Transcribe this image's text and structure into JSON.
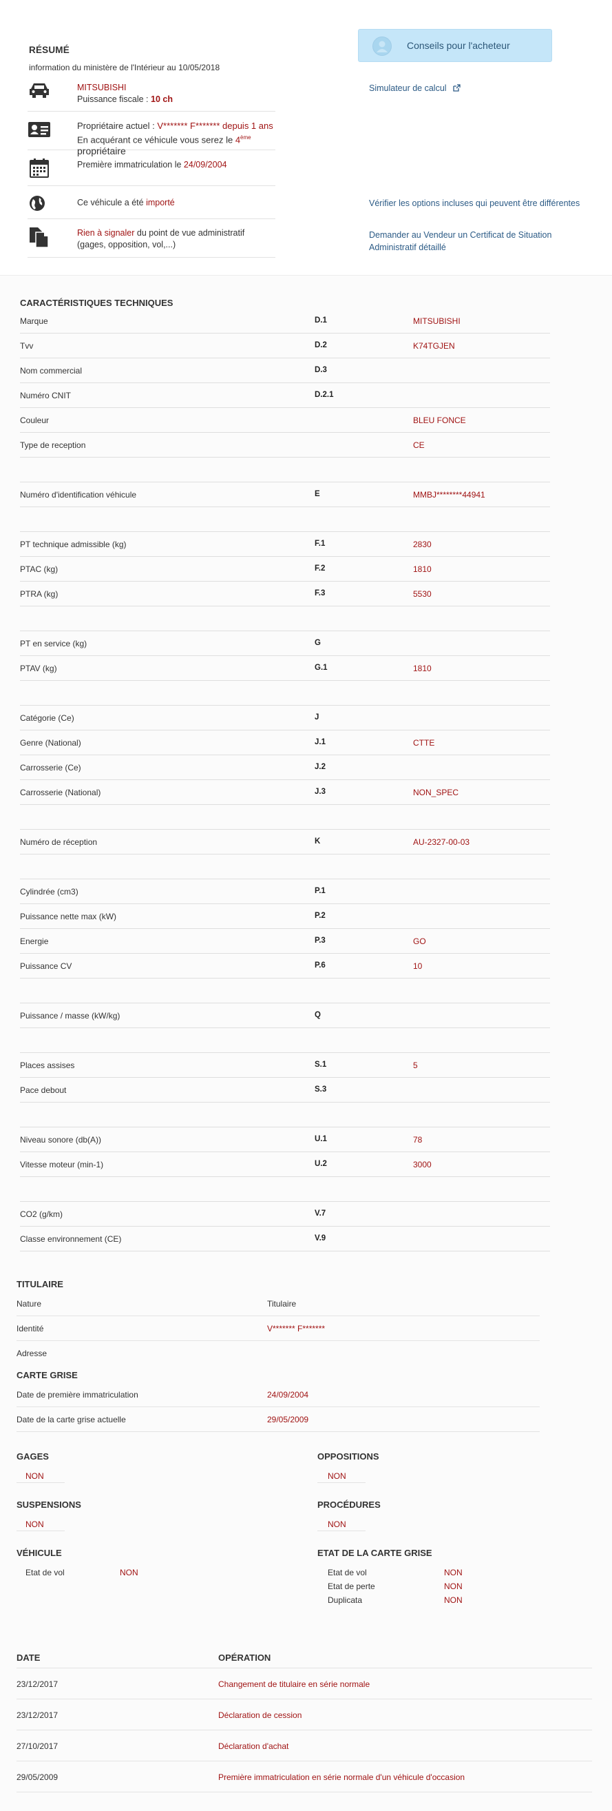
{
  "summary": {
    "title": "RÉSUMÉ",
    "subtitle": "information du ministère de l'Intérieur au 10/05/2018",
    "brand": "MITSUBISHI",
    "fiscal_label": "Puissance fiscale : ",
    "fiscal_value": "10 ch",
    "owner_label": "Propriétaire actuel : ",
    "owner_value": "V******* F******* depuis 1 ans",
    "owner_line2_a": "En acquérant ce véhicule vous serez le ",
    "owner_rank": "4",
    "owner_rank_sup": "ème",
    "owner_line2_b": " propriétaire",
    "first_reg_label": "Première immatriculation le ",
    "first_reg_value": "24/09/2004",
    "import_label": "Ce véhicule a été ",
    "import_value": "importé",
    "admin_red": "Rien à signaler",
    "admin_rest": " du point de vue administratif",
    "admin_line2": "(gages, opposition, vol,...)",
    "advice_button": "Conseils pour l'acheteur",
    "simulator_link": "Simulateur de calcul",
    "options_link": "Vérifier les options incluses qui peuvent être différentes",
    "certificate_link_1": "Demander au Vendeur un Certificat de Situation",
    "certificate_link_2": "Administratif détaillé"
  },
  "tech": {
    "title": "CARACTÉRISTIQUES TECHNIQUES",
    "rows": [
      {
        "label": "Marque",
        "code": "D.1",
        "value": "MITSUBISHI"
      },
      {
        "label": "Tvv",
        "code": "D.2",
        "value": "K74TGJEN"
      },
      {
        "label": "Nom commercial",
        "code": "D.3",
        "value": ""
      },
      {
        "label": "Numéro CNIT",
        "code": "D.2.1",
        "value": ""
      },
      {
        "label": "Couleur",
        "code": "",
        "value": "BLEU FONCE"
      },
      {
        "label": "Type de reception",
        "code": "",
        "value": "CE"
      },
      {
        "label": "",
        "code": "",
        "value": ""
      },
      {
        "label": "Numéro d'identification véhicule",
        "code": "E",
        "value": "MMBJ********44941"
      },
      {
        "label": "",
        "code": "",
        "value": ""
      },
      {
        "label": "PT technique admissible (kg)",
        "code": "F.1",
        "value": "2830"
      },
      {
        "label": "PTAC (kg)",
        "code": "F.2",
        "value": "1810"
      },
      {
        "label": "PTRA (kg)",
        "code": "F.3",
        "value": "5530"
      },
      {
        "label": "",
        "code": "",
        "value": ""
      },
      {
        "label": "PT en service (kg)",
        "code": "G",
        "value": ""
      },
      {
        "label": "PTAV (kg)",
        "code": "G.1",
        "value": "1810"
      },
      {
        "label": "",
        "code": "",
        "value": ""
      },
      {
        "label": "Catégorie (Ce)",
        "code": "J",
        "value": ""
      },
      {
        "label": "Genre (National)",
        "code": "J.1",
        "value": "CTTE"
      },
      {
        "label": "Carrosserie (Ce)",
        "code": "J.2",
        "value": ""
      },
      {
        "label": "Carrosserie (National)",
        "code": "J.3",
        "value": "NON_SPEC"
      },
      {
        "label": "",
        "code": "",
        "value": ""
      },
      {
        "label": "Numéro de réception",
        "code": "K",
        "value": "AU-2327-00-03"
      },
      {
        "label": "",
        "code": "",
        "value": ""
      },
      {
        "label": "Cylindrée (cm3)",
        "code": "P.1",
        "value": ""
      },
      {
        "label": "Puissance nette max (kW)",
        "code": "P.2",
        "value": ""
      },
      {
        "label": "Energie",
        "code": "P.3",
        "value": "GO"
      },
      {
        "label": "Puissance CV",
        "code": "P.6",
        "value": "10"
      },
      {
        "label": "",
        "code": "",
        "value": ""
      },
      {
        "label": "Puissance / masse (kW/kg)",
        "code": "Q",
        "value": ""
      },
      {
        "label": "",
        "code": "",
        "value": ""
      },
      {
        "label": "Places assises",
        "code": "S.1",
        "value": "5"
      },
      {
        "label": "Pace debout",
        "code": "S.3",
        "value": ""
      },
      {
        "label": "",
        "code": "",
        "value": ""
      },
      {
        "label": "Niveau sonore (db(A))",
        "code": "U.1",
        "value": "78"
      },
      {
        "label": "Vitesse moteur (min-1)",
        "code": "U.2",
        "value": "3000"
      },
      {
        "label": "",
        "code": "",
        "value": ""
      },
      {
        "label": "CO2 (g/km)",
        "code": "V.7",
        "value": ""
      },
      {
        "label": "Classe environnement (CE)",
        "code": "V.9",
        "value": ""
      }
    ]
  },
  "titulaire": {
    "title": "TITULAIRE",
    "nature_label": "Nature",
    "nature_value": "Titulaire",
    "identity_label": "Identité",
    "identity_value": "V******* F*******",
    "address_label": "Adresse"
  },
  "carte": {
    "title": "CARTE GRISE",
    "first_label": "Date de première immatriculation",
    "first_value": "24/09/2004",
    "current_label": "Date de la carte grise actuelle",
    "current_value": "29/05/2009"
  },
  "status": {
    "gages": "GAGES",
    "gages_value": "NON",
    "oppositions": "OPPOSITIONS",
    "oppositions_value": "NON",
    "suspensions": "SUSPENSIONS",
    "suspensions_value": "NON",
    "procedures": "PROCÉDURES",
    "procedures_value": "NON",
    "vehicule": "VÉHICULE",
    "vol_label": "Etat de vol",
    "vol_value": "NON",
    "etat_carte": "ETAT DE LA CARTE GRISE",
    "ec_vol_label": "Etat de vol",
    "ec_vol_value": "NON",
    "ec_perte_label": "Etat de perte",
    "ec_perte_value": "NON",
    "ec_dup_label": "Duplicata",
    "ec_dup_value": "NON"
  },
  "history": {
    "col_date": "DATE",
    "col_op": "OPÉRATION",
    "rows": [
      {
        "date": "23/12/2017",
        "op": "Changement de titulaire en série normale"
      },
      {
        "date": "23/12/2017",
        "op": "Déclaration de cession"
      },
      {
        "date": "27/10/2017",
        "op": "Déclaration d'achat"
      },
      {
        "date": "29/05/2009",
        "op": "Première immatriculation en série normale d'un véhicule d'occasion"
      }
    ]
  },
  "icons": [
    "car-icon",
    "owner-card-icon",
    "calendar-icon",
    "globe-icon",
    "documents-icon",
    "external-link-icon",
    "user-avatar-icon"
  ]
}
